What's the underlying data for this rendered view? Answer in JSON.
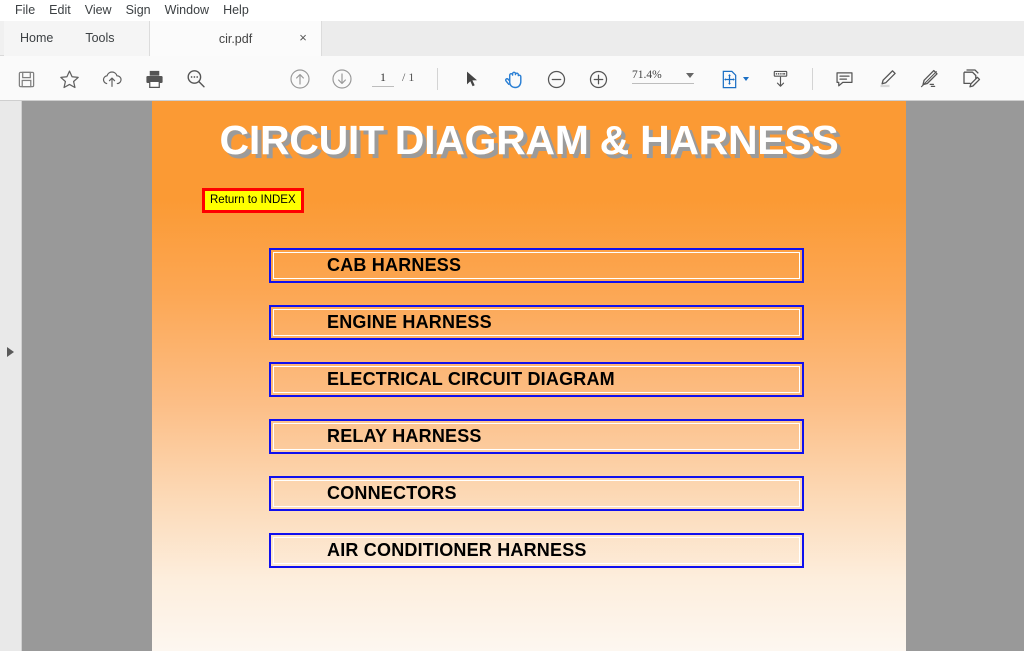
{
  "menubar": {
    "items": [
      {
        "label": "File",
        "name": "menu-file"
      },
      {
        "label": "Edit",
        "name": "menu-edit"
      },
      {
        "label": "View",
        "name": "menu-view"
      },
      {
        "label": "Sign",
        "name": "menu-sign"
      },
      {
        "label": "Window",
        "name": "menu-window"
      },
      {
        "label": "Help",
        "name": "menu-help"
      }
    ]
  },
  "tabs": {
    "home_label": "Home",
    "tools_label": "Tools",
    "document_tab": "cir.pdf",
    "close_glyph": "×"
  },
  "toolbar": {
    "save_icon": "save-icon",
    "star_icon": "star-icon",
    "cloud_upload_icon": "cloud-upload-icon",
    "print_icon": "print-icon",
    "find_icon": "find-icon",
    "prev_page_icon": "arrow-up-circle-icon",
    "next_page_icon": "arrow-down-circle-icon",
    "page_current": "1",
    "page_total": "/ 1",
    "page_placeholder": "1",
    "select_tool_icon": "cursor-arrow-icon",
    "hand_tool_icon": "hand-tool-icon",
    "zoom_out_icon": "zoom-out-icon",
    "zoom_in_icon": "zoom-in-icon",
    "zoom_level": "71.4%",
    "fit_page_icon": "fit-page-icon",
    "scroll_mode_icon": "scroll-mode-icon",
    "comment_icon": "comment-icon",
    "highlight_icon": "highlight-icon",
    "draw_icon": "draw-icon",
    "sign_icon": "sign-icon"
  },
  "navpane": {
    "expand_icon": "expand-panel-icon"
  },
  "document": {
    "title": "CIRCUIT DIAGRAM & HARNESS",
    "return_button": "Return to INDEX",
    "buttons": [
      {
        "label": "CAB HARNESS",
        "name": "doc-link-cab-harness"
      },
      {
        "label": "ENGINE HARNESS",
        "name": "doc-link-engine-harness"
      },
      {
        "label": "ELECTRICAL CIRCUIT DIAGRAM",
        "name": "doc-link-electrical-circuit-diagram"
      },
      {
        "label": "RELAY HARNESS",
        "name": "doc-link-relay-harness"
      },
      {
        "label": "CONNECTORS",
        "name": "doc-link-connectors"
      },
      {
        "label": "AIR CONDITIONER HARNESS",
        "name": "doc-link-air-conditioner-harness"
      }
    ]
  },
  "colors": {
    "page_top": "#fb9a34",
    "page_bottom": "#fdf7f0",
    "button_border": "#1010ee",
    "return_border": "#ff0000",
    "return_fill": "#ffff00",
    "title_text": "#ffffff",
    "title_shadow": "#9b9b9b",
    "viewer_bg": "#999999",
    "accent": "#1b6fc4"
  }
}
